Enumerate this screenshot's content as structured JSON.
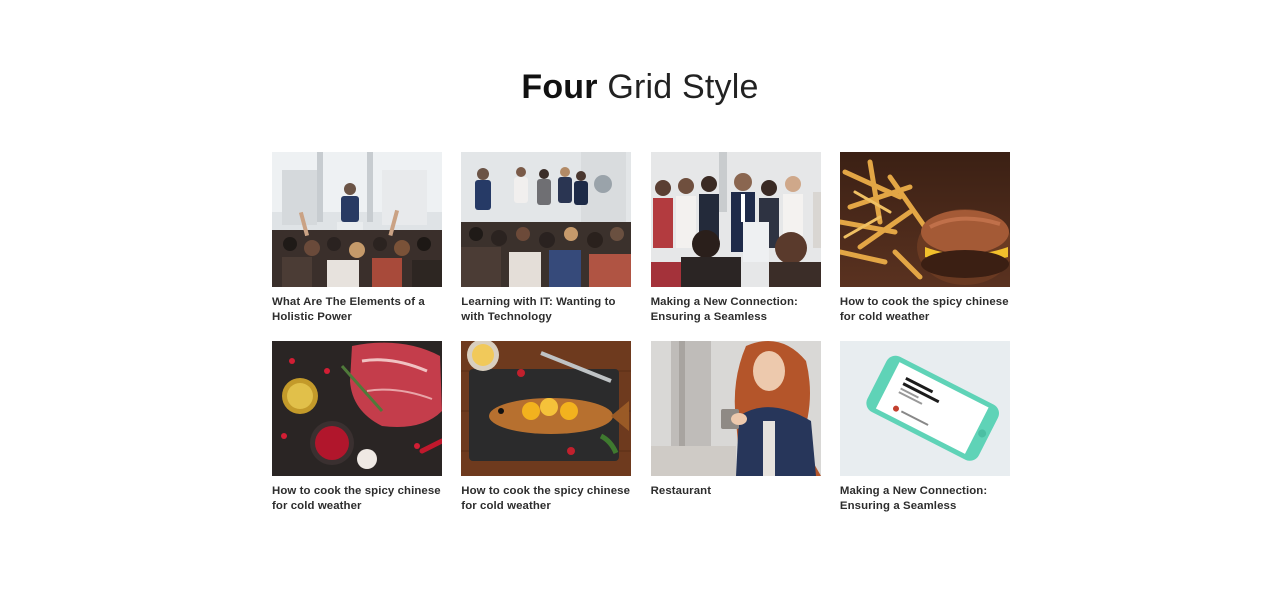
{
  "heading": {
    "bold": "Four",
    "light": "Grid Style"
  },
  "cards": [
    {
      "title": "What Are The Elements of a Holistic Power",
      "image": "conference-audience"
    },
    {
      "title": "Learning with IT: Wanting to with Technology",
      "image": "conference-speaker-stage"
    },
    {
      "title": "Making a New Connection: Ensuring a Seamless",
      "image": "applauding-business-team"
    },
    {
      "title": "How to cook the spicy chinese for cold weather",
      "image": "fries-and-burger"
    },
    {
      "title": "How to cook the spicy chinese for cold weather",
      "image": "raw-meat-and-spices"
    },
    {
      "title": "How to cook the spicy chinese for cold weather",
      "image": "grilled-fish-with-lemon"
    },
    {
      "title": "Restaurant",
      "image": "woman-holding-mug"
    },
    {
      "title": "Making a New Connection: Ensuring a Seamless",
      "image": "phone-mockup"
    }
  ]
}
